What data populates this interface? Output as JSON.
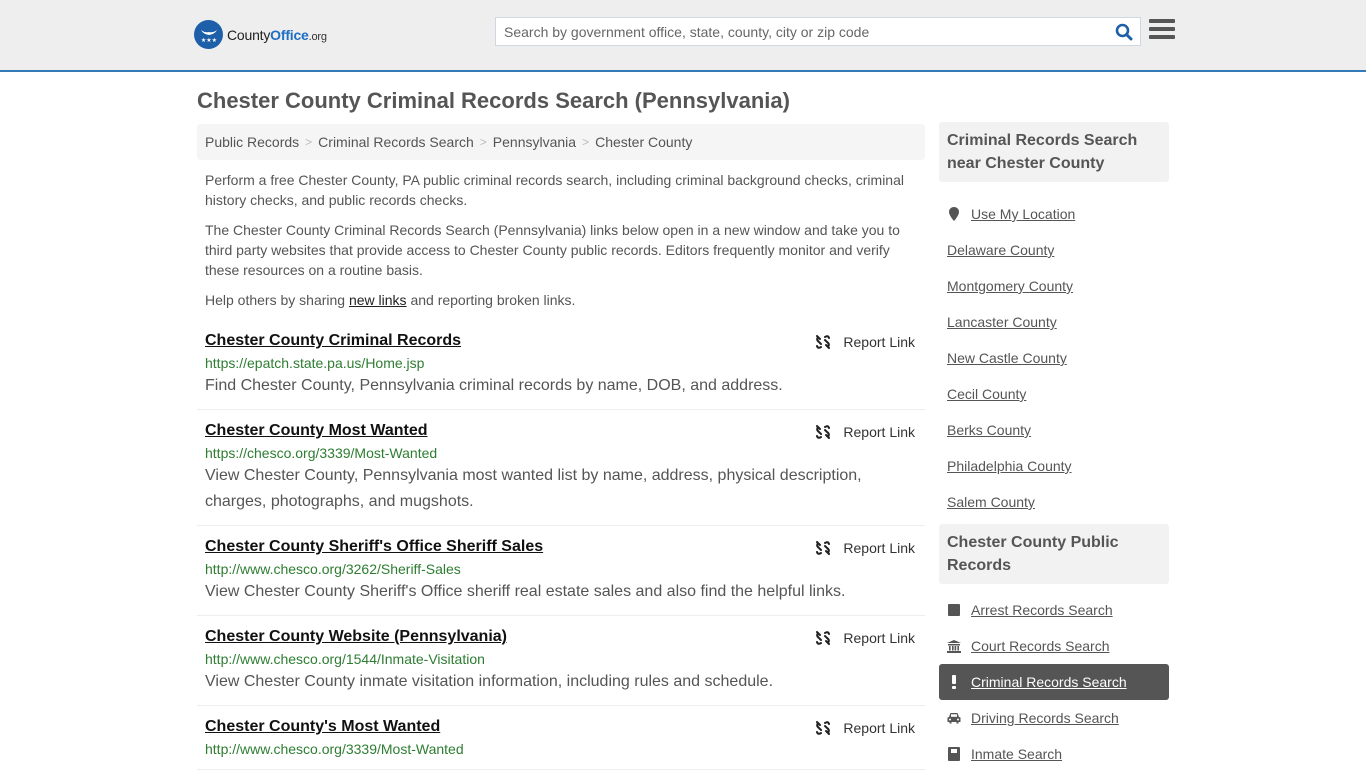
{
  "header": {
    "logo": {
      "name_part1": "County",
      "name_part2": "Office",
      "name_part3": ".org"
    },
    "search": {
      "placeholder": "Search by government office, state, county, city or zip code",
      "value": ""
    },
    "colors": {
      "accent": "#337ab7",
      "brand": "#1d6fc4",
      "url_green": "#2e7d32"
    }
  },
  "page": {
    "title": "Chester County Criminal Records Search (Pennsylvania)"
  },
  "breadcrumb": [
    {
      "label": "Public Records"
    },
    {
      "label": "Criminal Records Search"
    },
    {
      "label": "Pennsylvania"
    },
    {
      "label": "Chester County"
    }
  ],
  "intro": {
    "p1": "Perform a free Chester County, PA public criminal records search, including criminal background checks, criminal history checks, and public records checks.",
    "p2": "The Chester County Criminal Records Search (Pennsylvania) links below open in a new window and take you to third party websites that provide access to Chester County public records. Editors frequently monitor and verify these resources on a routine basis.",
    "p3_before": "Help others by sharing ",
    "p3_link": "new links",
    "p3_after": " and reporting broken links."
  },
  "report_label": "Report Link",
  "results": [
    {
      "title": "Chester County Criminal Records",
      "url": "https://epatch.state.pa.us/Home.jsp",
      "desc": "Find Chester County, Pennsylvania criminal records by name, DOB, and address."
    },
    {
      "title": "Chester County Most Wanted",
      "url": "https://chesco.org/3339/Most-Wanted",
      "desc": "View Chester County, Pennsylvania most wanted list by name, address, physical description, charges, photographs, and mugshots."
    },
    {
      "title": "Chester County Sheriff's Office Sheriff Sales",
      "url": "http://www.chesco.org/3262/Sheriff-Sales",
      "desc": "View Chester County Sheriff's Office sheriff real estate sales and also find the helpful links."
    },
    {
      "title": "Chester County Website (Pennsylvania)",
      "url": "http://www.chesco.org/1544/Inmate-Visitation",
      "desc": "View Chester County inmate visitation information, including rules and schedule."
    },
    {
      "title": "Chester County's Most Wanted",
      "url": "http://www.chesco.org/3339/Most-Wanted",
      "desc": ""
    }
  ],
  "sidebar": {
    "nearby": {
      "heading": "Criminal Records Search near Chester County",
      "use_location": "Use My Location",
      "items": [
        {
          "label": "Delaware County"
        },
        {
          "label": "Montgomery County"
        },
        {
          "label": "Lancaster County"
        },
        {
          "label": "New Castle County"
        },
        {
          "label": "Cecil County"
        },
        {
          "label": "Berks County"
        },
        {
          "label": "Philadelphia County"
        },
        {
          "label": "Salem County"
        }
      ]
    },
    "public_records": {
      "heading": "Chester County Public Records",
      "items": [
        {
          "label": "Arrest Records Search",
          "icon": "square-icon"
        },
        {
          "label": "Court Records Search",
          "icon": "courthouse-icon"
        },
        {
          "label": "Criminal Records Search",
          "icon": "exclamation-icon",
          "active": true
        },
        {
          "label": "Driving Records Search",
          "icon": "car-icon"
        },
        {
          "label": "Inmate Search",
          "icon": "inmate-icon"
        }
      ]
    }
  }
}
